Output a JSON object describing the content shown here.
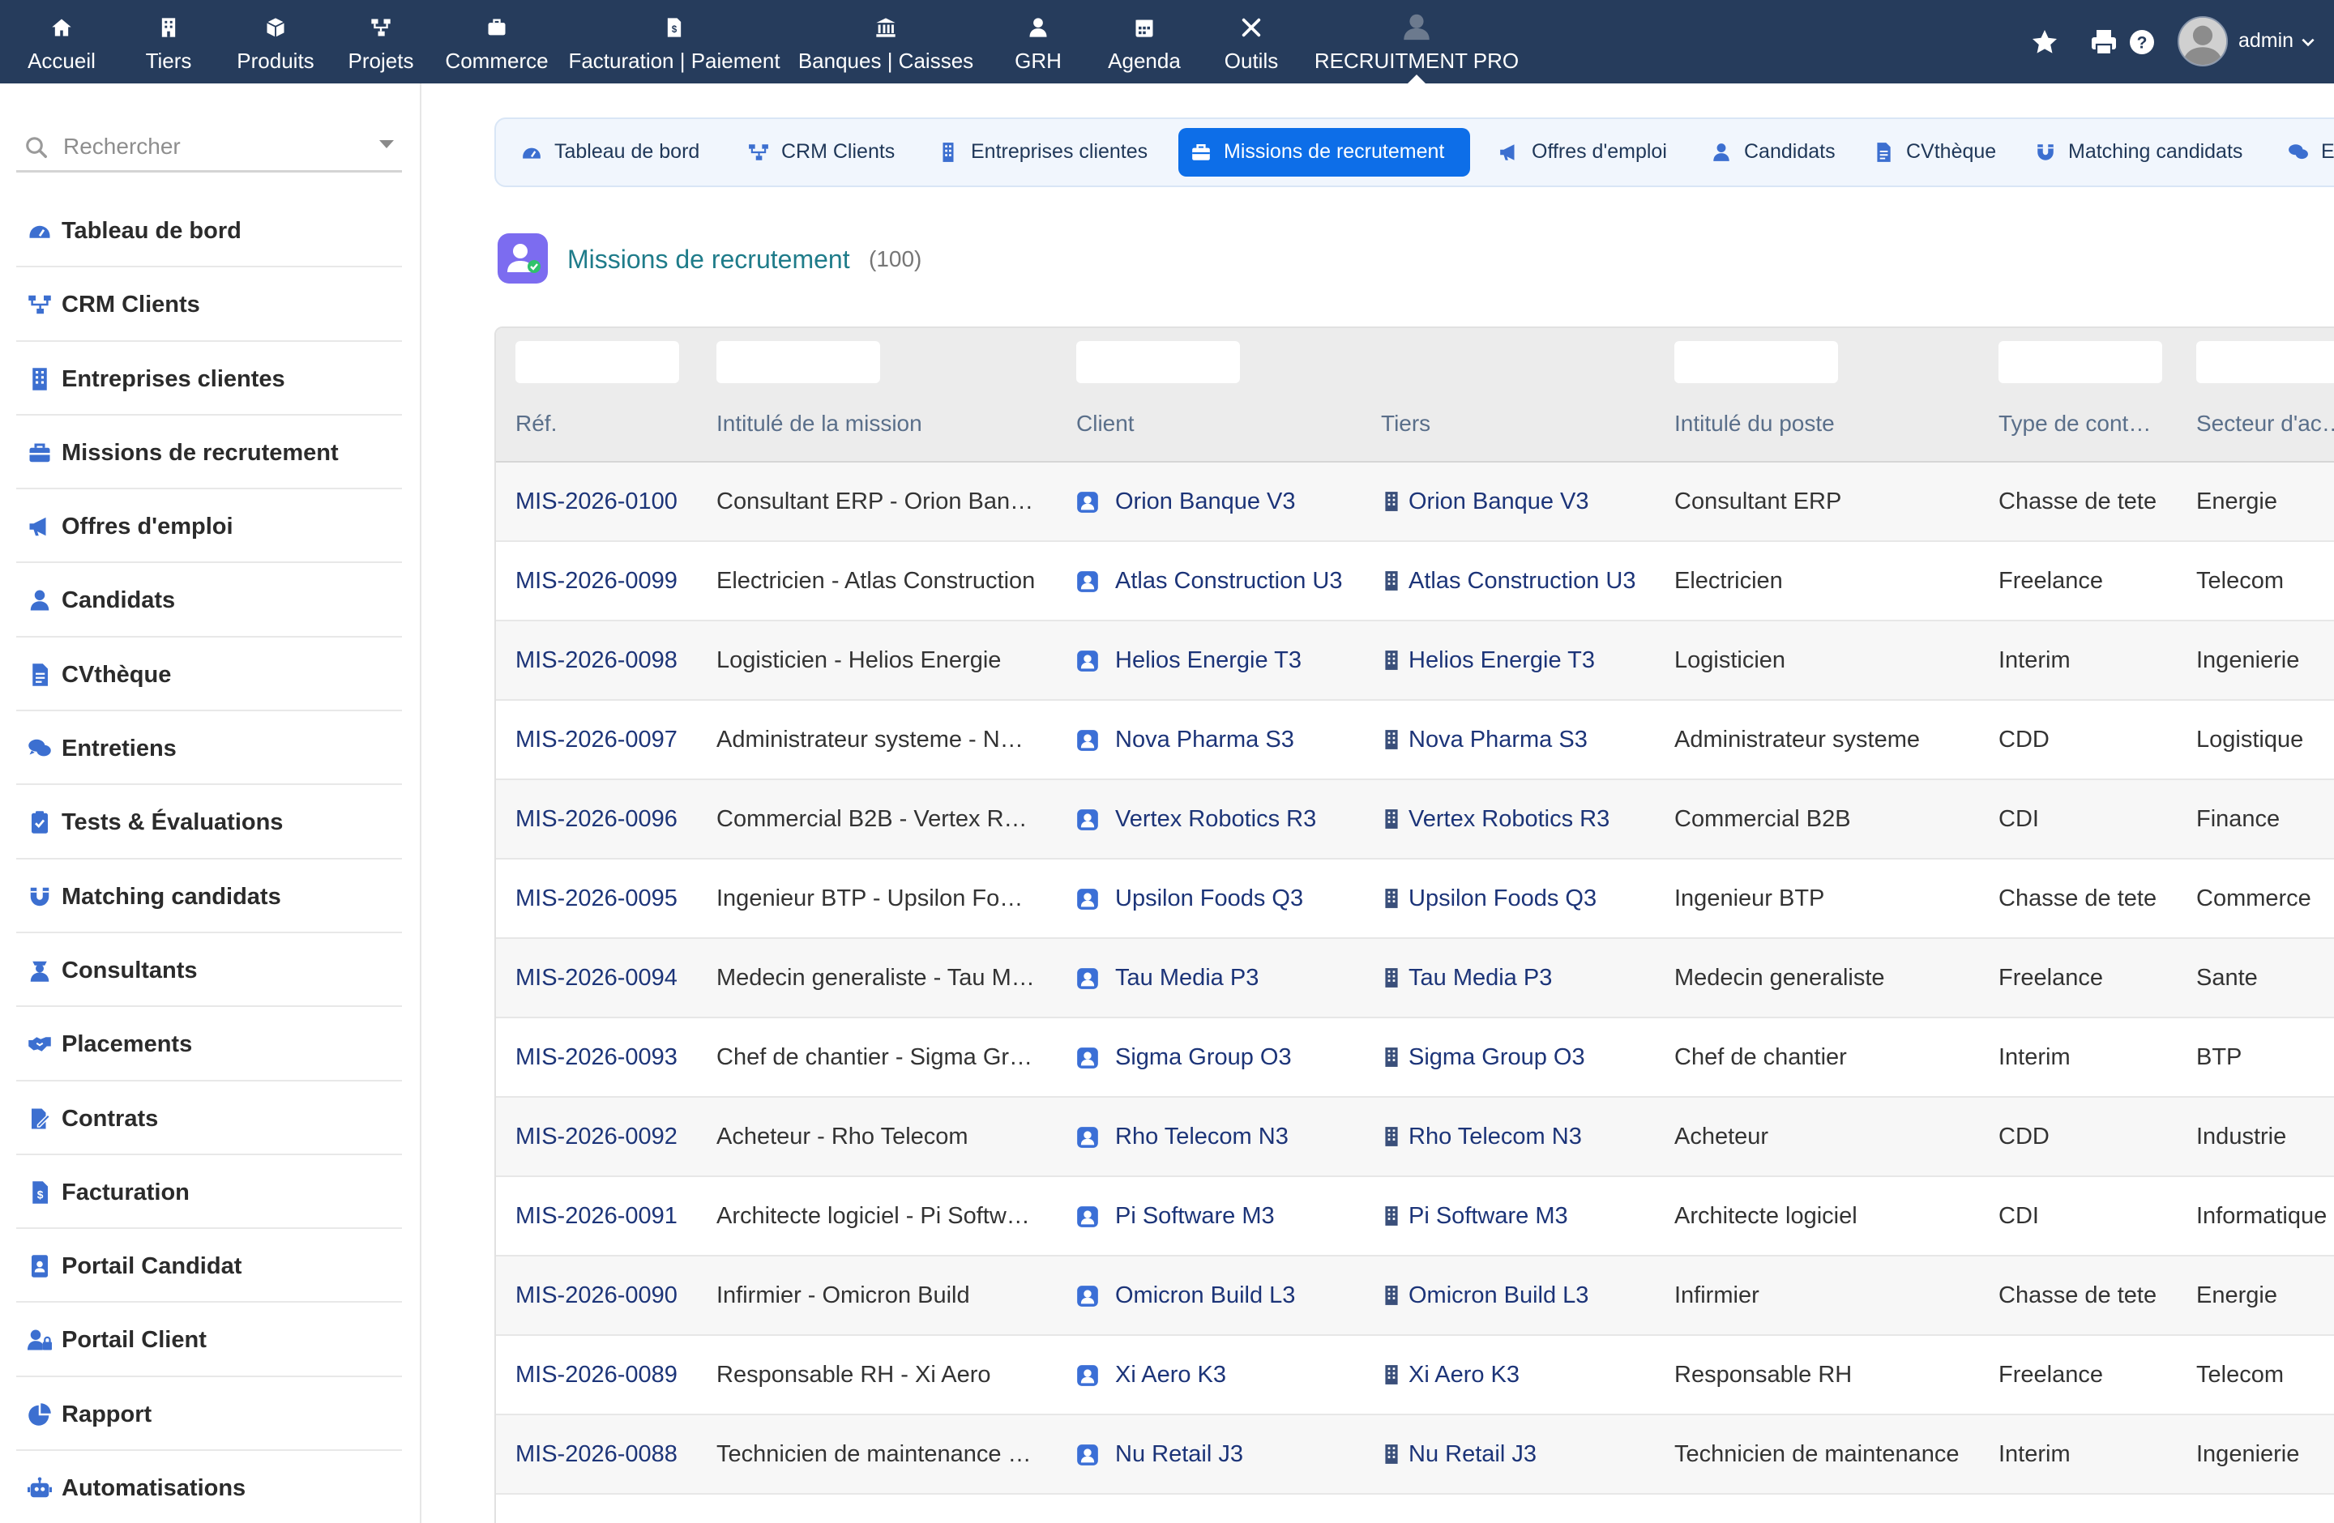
{
  "topnav": {
    "items": [
      {
        "label": "Accueil",
        "icon": "home-icon"
      },
      {
        "label": "Tiers",
        "icon": "building-icon"
      },
      {
        "label": "Produits",
        "icon": "cube-icon"
      },
      {
        "label": "Projets",
        "icon": "project-icon"
      },
      {
        "label": "Commerce",
        "icon": "suitcase-icon"
      },
      {
        "label": "Facturation | Paiement",
        "icon": "invoice-icon"
      },
      {
        "label": "Banques | Caisses",
        "icon": "bank-icon"
      },
      {
        "label": "GRH",
        "icon": "user-icon"
      },
      {
        "label": "Agenda",
        "icon": "calendar-icon"
      },
      {
        "label": "Outils",
        "icon": "tools-icon"
      },
      {
        "label": "RECRUITMENT PRO",
        "icon": "recruitment-icon"
      }
    ],
    "user": "admin"
  },
  "sidebar": {
    "search_placeholder": "Rechercher",
    "items": [
      {
        "label": "Tableau de bord",
        "icon": "dashboard-icon"
      },
      {
        "label": "CRM Clients",
        "icon": "crm-icon"
      },
      {
        "label": "Entreprises clientes",
        "icon": "building-icon"
      },
      {
        "label": "Missions de recrutement",
        "icon": "briefcase-icon"
      },
      {
        "label": "Offres d'emploi",
        "icon": "megaphone-icon"
      },
      {
        "label": "Candidats",
        "icon": "user-icon"
      },
      {
        "label": "CVthèque",
        "icon": "document-icon"
      },
      {
        "label": "Entretiens",
        "icon": "comments-icon"
      },
      {
        "label": "Tests & Évaluations",
        "icon": "clipboard-check-icon"
      },
      {
        "label": "Matching candidats",
        "icon": "magnet-icon"
      },
      {
        "label": "Consultants",
        "icon": "consultant-icon"
      },
      {
        "label": "Placements",
        "icon": "handshake-icon"
      },
      {
        "label": "Contrats",
        "icon": "contract-icon"
      },
      {
        "label": "Facturation",
        "icon": "invoice-icon"
      },
      {
        "label": "Portail Candidat",
        "icon": "id-badge-icon"
      },
      {
        "label": "Portail Client",
        "icon": "user-lock-icon"
      },
      {
        "label": "Rapport",
        "icon": "pie-chart-icon"
      },
      {
        "label": "Automatisations",
        "icon": "robot-icon"
      }
    ]
  },
  "tabs": [
    {
      "label": "Tableau de bord",
      "icon": "dashboard-icon"
    },
    {
      "label": "CRM Clients",
      "icon": "crm-icon"
    },
    {
      "label": "Entreprises clientes",
      "icon": "building-icon"
    },
    {
      "label": "Missions de recrutement",
      "icon": "briefcase-icon",
      "active": true
    },
    {
      "label": "Offres d'emploi",
      "icon": "megaphone-icon"
    },
    {
      "label": "Candidats",
      "icon": "user-icon"
    },
    {
      "label": "CVthèque",
      "icon": "document-icon"
    },
    {
      "label": "Matching candidats",
      "icon": "magnet-icon"
    },
    {
      "label": "E",
      "icon": "comments-icon"
    }
  ],
  "page": {
    "title": "Missions de recrutement",
    "count": "(100)"
  },
  "table": {
    "headers": [
      "Réf.",
      "Intitulé de la mission",
      "Client",
      "Tiers",
      "Intitulé du poste",
      "Type de cont…",
      "Secteur d'ac…"
    ],
    "rows": [
      {
        "ref": "MIS-2026-0100",
        "mission": "Consultant ERP - Orion Ban…",
        "client": "Orion Banque V3",
        "tiers": "Orion Banque V3",
        "poste": "Consultant ERP",
        "type": "Chasse de tete",
        "secteur": "Energie"
      },
      {
        "ref": "MIS-2026-0099",
        "mission": "Electricien - Atlas Construction",
        "client": "Atlas Construction U3",
        "tiers": "Atlas Construction U3",
        "poste": "Electricien",
        "type": "Freelance",
        "secteur": "Telecom"
      },
      {
        "ref": "MIS-2026-0098",
        "mission": "Logisticien - Helios Energie",
        "client": "Helios Energie T3",
        "tiers": "Helios Energie T3",
        "poste": "Logisticien",
        "type": "Interim",
        "secteur": "Ingenierie"
      },
      {
        "ref": "MIS-2026-0097",
        "mission": "Administrateur systeme - N…",
        "client": "Nova Pharma S3",
        "tiers": "Nova Pharma S3",
        "poste": "Administrateur systeme",
        "type": "CDD",
        "secteur": "Logistique"
      },
      {
        "ref": "MIS-2026-0096",
        "mission": "Commercial B2B - Vertex R…",
        "client": "Vertex Robotics R3",
        "tiers": "Vertex Robotics R3",
        "poste": "Commercial B2B",
        "type": "CDI",
        "secteur": "Finance"
      },
      {
        "ref": "MIS-2026-0095",
        "mission": "Ingenieur BTP - Upsilon Fo…",
        "client": "Upsilon Foods Q3",
        "tiers": "Upsilon Foods Q3",
        "poste": "Ingenieur BTP",
        "type": "Chasse de tete",
        "secteur": "Commerce"
      },
      {
        "ref": "MIS-2026-0094",
        "mission": "Medecin generaliste - Tau M…",
        "client": "Tau Media P3",
        "tiers": "Tau Media P3",
        "poste": "Medecin generaliste",
        "type": "Freelance",
        "secteur": "Sante"
      },
      {
        "ref": "MIS-2026-0093",
        "mission": "Chef de chantier - Sigma Gr…",
        "client": "Sigma Group O3",
        "tiers": "Sigma Group O3",
        "poste": "Chef de chantier",
        "type": "Interim",
        "secteur": "BTP"
      },
      {
        "ref": "MIS-2026-0092",
        "mission": "Acheteur - Rho Telecom",
        "client": "Rho Telecom N3",
        "tiers": "Rho Telecom N3",
        "poste": "Acheteur",
        "type": "CDD",
        "secteur": "Industrie"
      },
      {
        "ref": "MIS-2026-0091",
        "mission": "Architecte logiciel - Pi Softw…",
        "client": "Pi Software M3",
        "tiers": "Pi Software M3",
        "poste": "Architecte logiciel",
        "type": "CDI",
        "secteur": "Informatique"
      },
      {
        "ref": "MIS-2026-0090",
        "mission": "Infirmier - Omicron Build",
        "client": "Omicron Build L3",
        "tiers": "Omicron Build L3",
        "poste": "Infirmier",
        "type": "Chasse de tete",
        "secteur": "Energie"
      },
      {
        "ref": "MIS-2026-0089",
        "mission": "Responsable RH - Xi Aero",
        "client": "Xi Aero K3",
        "tiers": "Xi Aero K3",
        "poste": "Responsable RH",
        "type": "Freelance",
        "secteur": "Telecom"
      },
      {
        "ref": "MIS-2026-0088",
        "mission": "Technicien de maintenance …",
        "client": "Nu Retail J3",
        "tiers": "Nu Retail J3",
        "poste": "Technicien de maintenance",
        "type": "Interim",
        "secteur": "Ingenierie"
      }
    ]
  },
  "colors": {
    "topbar": "#263c5c",
    "tab_active": "#0d6ee8",
    "link": "#1c3478",
    "title": "#1f7c8a",
    "client_icon": "#3b6fd6"
  }
}
